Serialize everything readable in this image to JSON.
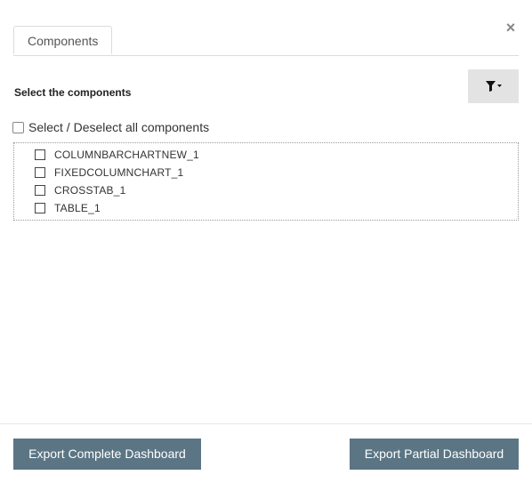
{
  "dialog": {
    "close_label": "×",
    "tabs": [
      {
        "label": "Components"
      }
    ],
    "section_label": "Select the components",
    "filter_button": {
      "icon": "filter-icon"
    },
    "select_all_label": "Select / Deselect all components",
    "components": [
      {
        "label": "COLUMNBARCHARTNEW_1",
        "checked": false
      },
      {
        "label": "FIXEDCOLUMNCHART_1",
        "checked": false
      },
      {
        "label": "CROSSTAB_1",
        "checked": false
      },
      {
        "label": "TABLE_1",
        "checked": false
      }
    ],
    "buttons": {
      "export_complete": "Export Complete Dashboard",
      "export_partial": "Export Partial Dashboard"
    },
    "colors": {
      "button_bg": "#5b7584",
      "filter_bg": "#e3e3e3"
    }
  }
}
